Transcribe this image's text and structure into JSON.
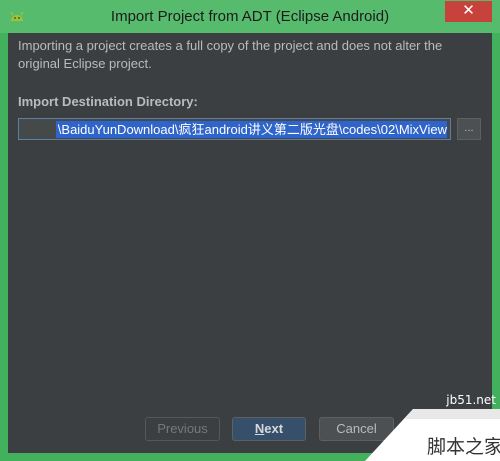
{
  "window": {
    "title": "Import Project from ADT (Eclipse Android)",
    "close_glyph": "✕"
  },
  "dialog": {
    "description": "Importing a project creates a full copy of the project and does not alter the original Eclipse project.",
    "destination_label": "Import Destination Directory:",
    "destination_value": "\\BaiduYunDownload\\疯狂android讲义第二版光盘\\codes\\02\\MixView",
    "browse_label": "..."
  },
  "buttons": {
    "previous": "Previous",
    "next_mnemonic": "N",
    "next_rest": "ext",
    "cancel": "Cancel"
  },
  "watermark": {
    "url": "jb51.net",
    "brand": "脚本之家"
  },
  "icons": {
    "app": "android-icon",
    "close": "close-icon",
    "browse": "ellipsis-icon"
  }
}
